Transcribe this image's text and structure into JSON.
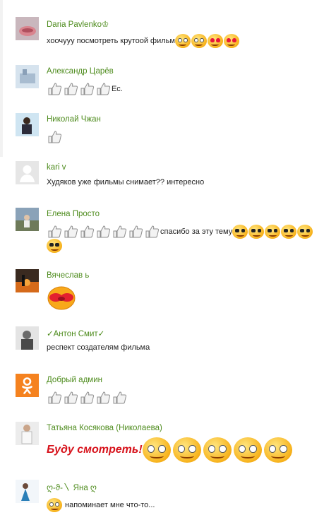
{
  "comments": [
    {
      "author": "Daria Pavlenko♔",
      "text": "хоочууу посмотреть крутоой фильм"
    },
    {
      "author": "Александр Царёв",
      "text": "Ес."
    },
    {
      "author": "Николай Чжан",
      "text": ""
    },
    {
      "author": "kari v",
      "text": "Худяков уже фильмы снимает?? интересно"
    },
    {
      "author": "Елена Просто",
      "text": "спасибо за эту тему"
    },
    {
      "author": "Вячеслав ь",
      "text": ""
    },
    {
      "author": "✓Антон Смит✓",
      "text": "респект создателям фильма"
    },
    {
      "author": "Добрый админ",
      "text": ""
    },
    {
      "author": "Татьяна Косякова (Николаева)",
      "text": "Буду смотреть!"
    },
    {
      "author": "ღ-ϑ-〵 Яна ღ",
      "text": "напоминает мне что-то..."
    }
  ],
  "colors": {
    "author": "#4d8b1c",
    "accent_red": "#d7121b",
    "ok_orange": "#f5821f"
  }
}
